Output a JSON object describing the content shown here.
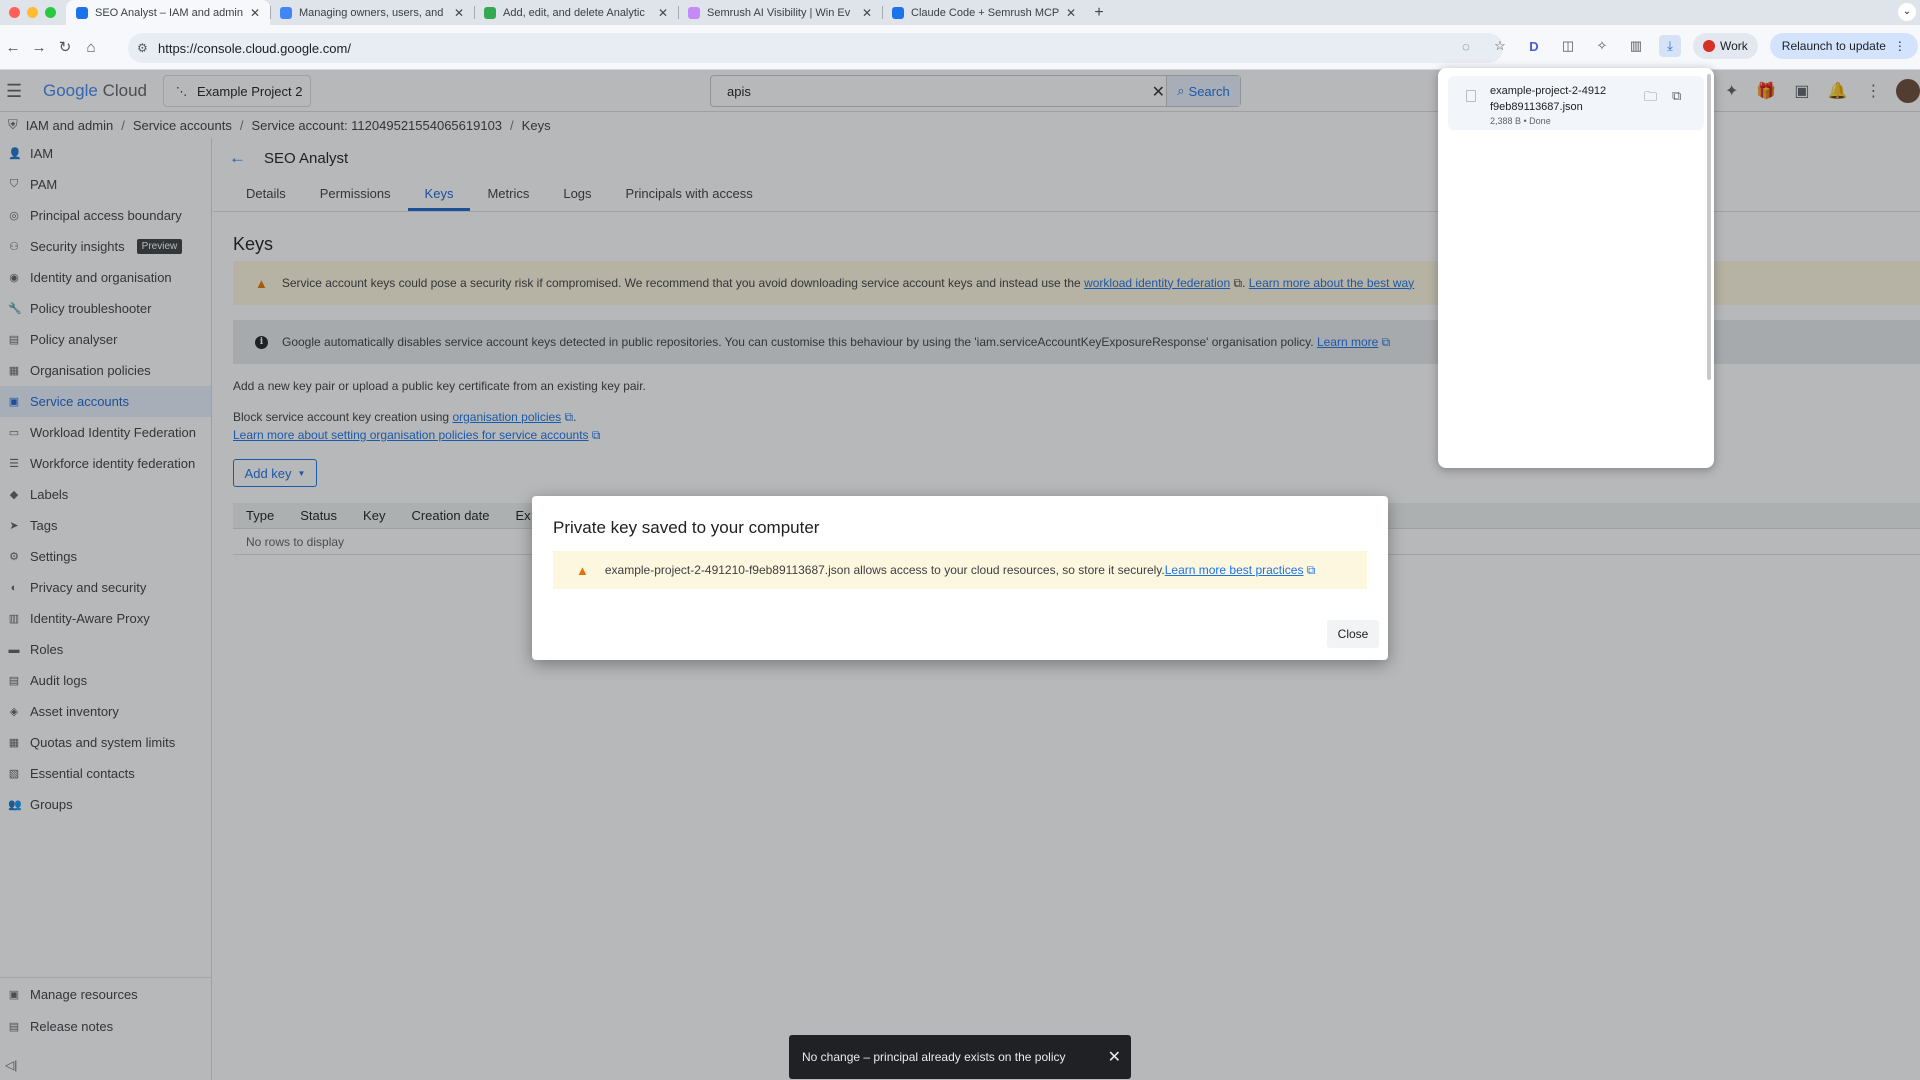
{
  "browser": {
    "tabs": [
      {
        "title": "SEO Analyst – IAM and admin",
        "fav": "#1a73e8",
        "active": true
      },
      {
        "title": "Managing owners, users, and",
        "fav": "#4285f4",
        "active": false
      },
      {
        "title": "Add, edit, and delete Analytic",
        "fav": "#34a853",
        "active": false
      },
      {
        "title": "Semrush AI Visibility | Win Ev",
        "fav": "#c58af9",
        "active": false
      },
      {
        "title": "Claude Code + Semrush MCP",
        "fav": "#1a73e8",
        "active": false
      }
    ],
    "new_tab": "+",
    "url": "https://console.cloud.google.com/",
    "profile_label": "Work",
    "relaunch_label": "Relaunch to update"
  },
  "header": {
    "logo_google": "Google",
    "logo_cloud": "Cloud",
    "project": "Example Project 2",
    "search_value": "apis",
    "search_button": "Search"
  },
  "breadcrumb": [
    "IAM and admin",
    "Service accounts",
    "Service account: 112049521554065619103",
    "Keys"
  ],
  "sidebar": {
    "items": [
      {
        "label": "IAM",
        "icon": "person-add-icon",
        "glyph": "👤"
      },
      {
        "label": "PAM",
        "icon": "shield-icon",
        "glyph": "⛉"
      },
      {
        "label": "Principal access boundary",
        "icon": "boundary-icon",
        "glyph": "◎"
      },
      {
        "label": "Security insights",
        "icon": "insights-icon",
        "glyph": "⚇",
        "badge": "Preview"
      },
      {
        "label": "Identity and organisation",
        "icon": "identity-icon",
        "glyph": "◉"
      },
      {
        "label": "Policy troubleshooter",
        "icon": "wrench-icon",
        "glyph": "🔧"
      },
      {
        "label": "Policy analyser",
        "icon": "analyser-icon",
        "glyph": "▤"
      },
      {
        "label": "Organisation policies",
        "icon": "org-policy-icon",
        "glyph": "▦"
      },
      {
        "label": "Service accounts",
        "icon": "service-account-icon",
        "glyph": "▣",
        "active": true
      },
      {
        "label": "Workload Identity Federation",
        "icon": "workload-icon",
        "glyph": "▭"
      },
      {
        "label": "Workforce identity federation",
        "icon": "workforce-icon",
        "glyph": "☰"
      },
      {
        "label": "Labels",
        "icon": "label-icon",
        "glyph": "◆"
      },
      {
        "label": "Tags",
        "icon": "tag-icon",
        "glyph": "➤"
      },
      {
        "label": "Settings",
        "icon": "gear-icon",
        "glyph": "⚙"
      },
      {
        "label": "Privacy and security",
        "icon": "privacy-icon",
        "glyph": "◐"
      },
      {
        "label": "Identity-Aware Proxy",
        "icon": "proxy-icon",
        "glyph": "▥"
      },
      {
        "label": "Roles",
        "icon": "roles-icon",
        "glyph": "▬"
      },
      {
        "label": "Audit logs",
        "icon": "audit-icon",
        "glyph": "▤"
      },
      {
        "label": "Asset inventory",
        "icon": "asset-icon",
        "glyph": "◈"
      },
      {
        "label": "Quotas and system limits",
        "icon": "quota-icon",
        "glyph": "▦"
      },
      {
        "label": "Essential contacts",
        "icon": "contacts-icon",
        "glyph": "▧"
      },
      {
        "label": "Groups",
        "icon": "groups-icon",
        "glyph": "👥"
      }
    ],
    "bottom": [
      {
        "label": "Manage resources",
        "icon": "manage-resources-icon",
        "glyph": "▣"
      },
      {
        "label": "Release notes",
        "icon": "release-notes-icon",
        "glyph": "▤"
      }
    ],
    "collapse_glyph": "◁|"
  },
  "page": {
    "title": "SEO Analyst",
    "tabs": [
      {
        "label": "Details",
        "active": false
      },
      {
        "label": "Permissions",
        "active": false
      },
      {
        "label": "Keys",
        "active": true
      },
      {
        "label": "Metrics",
        "active": false
      },
      {
        "label": "Logs",
        "active": false
      },
      {
        "label": "Principals with access",
        "active": false
      }
    ],
    "heading": "Keys",
    "warning": {
      "text": "Service account keys could pose a security risk if compromised. We recommend that you avoid downloading service account keys and instead use the ",
      "link1": "workload identity federation",
      "mid": ". ",
      "link2": "Learn more about the best way"
    },
    "info": {
      "text": "Google automatically disables service account keys detected in public repositories. You can customise this behaviour by using the 'iam.serviceAccountKeyExposureResponse' organisation policy. ",
      "link": "Learn more"
    },
    "add_text": "Add a new key pair or upload a public key certificate from an existing key pair.",
    "block_text": "Block service account key creation using ",
    "block_link": "organisation policies",
    "block_end": ".",
    "learn_link": "Learn more about setting organisation policies for service accounts",
    "add_key_label": "Add key",
    "table": {
      "columns": [
        "Type",
        "Status",
        "Key",
        "Creation date",
        "Ex"
      ],
      "empty": "No rows to display"
    }
  },
  "dialog": {
    "title": "Private key saved to your computer",
    "message": "example-project-2-491210-f9eb89113687.json allows access to your cloud resources, so store it securely.",
    "link": "Learn more best practices",
    "close_label": "Close"
  },
  "downloads": {
    "name_line1": "example-project-2-4912",
    "name_line2": "f9eb89113687.json",
    "meta": "2,388 B • Done"
  },
  "snackbar": {
    "text": "No change – principal already exists on the policy"
  },
  "colors": {
    "accent": "#1a73e8",
    "warning": "#e37400",
    "warning_bg": "#fef7e0",
    "info_bg": "#e8eaed"
  }
}
